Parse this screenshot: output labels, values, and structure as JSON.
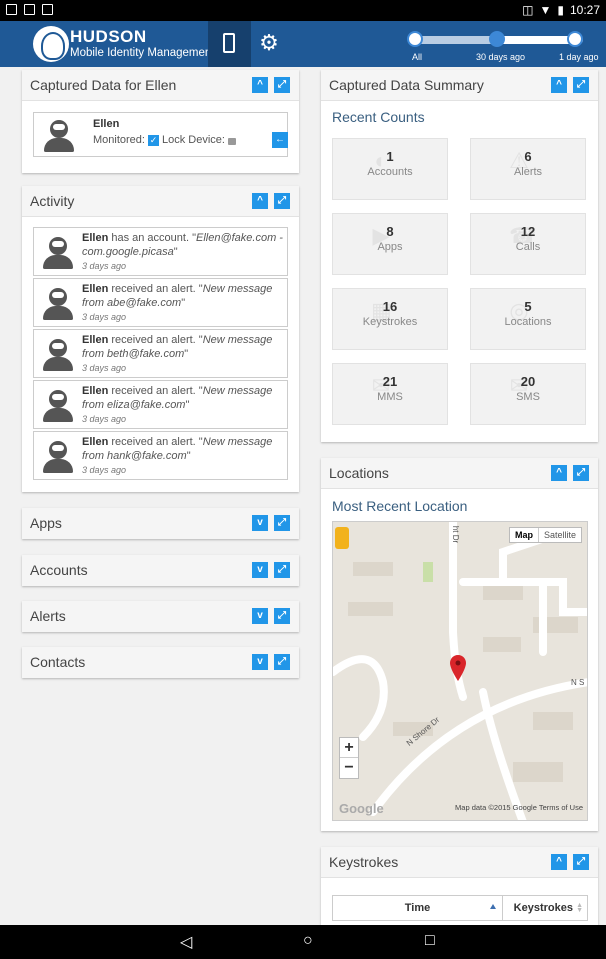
{
  "statusbar": {
    "time": "10:27"
  },
  "header": {
    "brand_title": "HUDSON",
    "brand_subtitle": "Mobile Identity Management",
    "time_labels": [
      "All",
      "30 days ago",
      "1 day ago"
    ],
    "time_selected": "30 days ago"
  },
  "captured": {
    "title": "Captured Data for Ellen",
    "name": "Ellen",
    "monitored_label": "Monitored:",
    "monitored": true,
    "lock_label": "Lock Device:"
  },
  "activity": {
    "title": "Activity",
    "items": [
      {
        "name": "Ellen",
        "action": " has an account. \"",
        "detail": "Ellen@fake.com - com.google.picasa",
        "close": "\"",
        "time": "3 days ago"
      },
      {
        "name": "Ellen",
        "action": " received an alert. \"",
        "detail": "New message from abe@fake.com",
        "close": "\"",
        "time": "3 days ago"
      },
      {
        "name": "Ellen",
        "action": " received an alert. \"",
        "detail": "New message from beth@fake.com",
        "close": "\"",
        "time": "3 days ago"
      },
      {
        "name": "Ellen",
        "action": " received an alert. \"",
        "detail": "New message from eliza@fake.com",
        "close": "\"",
        "time": "3 days ago"
      },
      {
        "name": "Ellen",
        "action": " received an alert. \"",
        "detail": "New message from hank@fake.com",
        "close": "\"",
        "time": "3 days ago"
      }
    ]
  },
  "collapsed_panels": [
    "Apps",
    "Accounts",
    "Alerts",
    "Contacts"
  ],
  "summary": {
    "title": "Captured Data Summary",
    "subtitle": "Recent Counts",
    "tiles": [
      {
        "count": "1",
        "label": "Accounts"
      },
      {
        "count": "6",
        "label": "Alerts"
      },
      {
        "count": "8",
        "label": "Apps"
      },
      {
        "count": "12",
        "label": "Calls"
      },
      {
        "count": "16",
        "label": "Keystrokes"
      },
      {
        "count": "5",
        "label": "Locations"
      },
      {
        "count": "21",
        "label": "MMS"
      },
      {
        "count": "20",
        "label": "SMS"
      }
    ]
  },
  "locations": {
    "title": "Locations",
    "subtitle": "Most Recent Location",
    "map_type_map": "Map",
    "map_type_satellite": "Satellite",
    "credit": "Map data ©2015 Google   Terms of Use",
    "google": "Google",
    "street1": "N Shore Dr",
    "street2": "N S",
    "street3": "ht Dr"
  },
  "keystrokes": {
    "title": "Keystrokes",
    "col_time": "Time",
    "col_keystrokes": "Keystrokes"
  },
  "colors": {
    "header": "#1f5996",
    "accent": "#2196e8",
    "pin": "#d9252a"
  }
}
